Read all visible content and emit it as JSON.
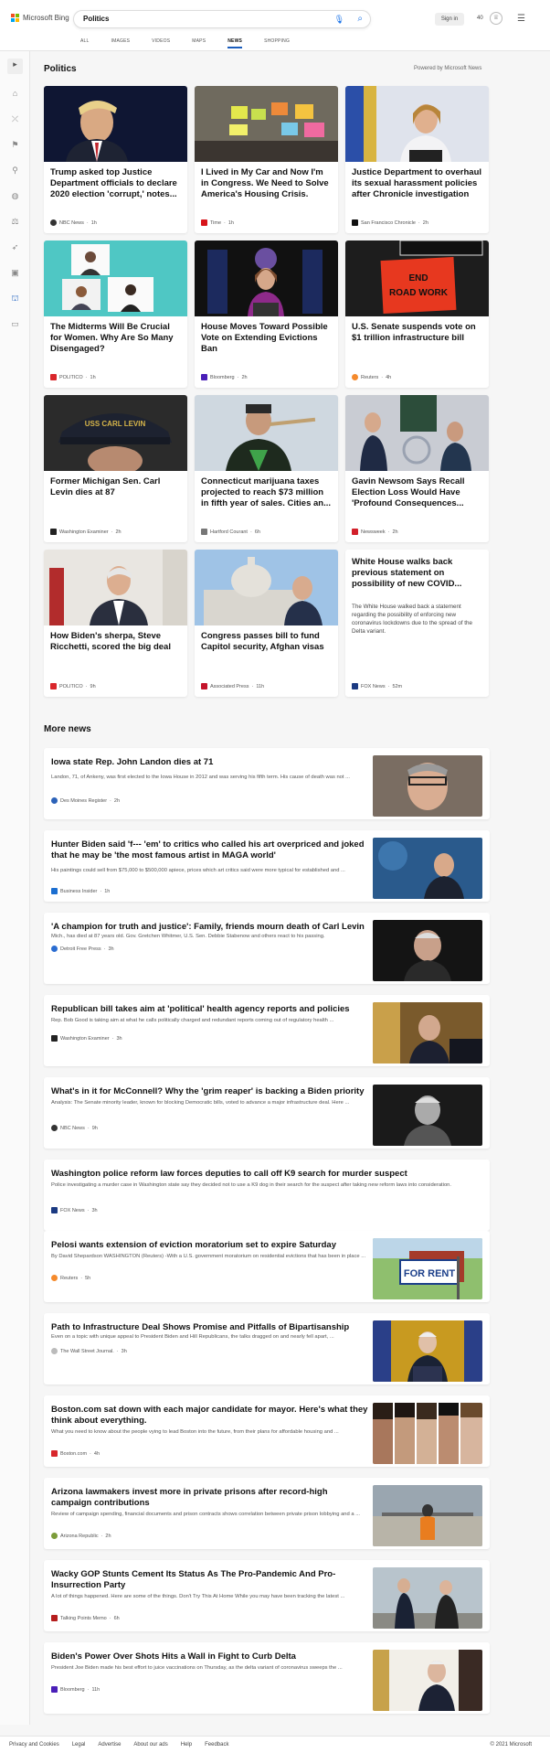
{
  "header": {
    "brand": "Microsoft Bing",
    "query": "Politics",
    "signin": "Sign in",
    "reward_points": "40",
    "tabs": [
      "ALL",
      "IMAGES",
      "VIDEOS",
      "MAPS",
      "NEWS",
      "SHOPPING"
    ],
    "active_tab": "NEWS"
  },
  "section": {
    "title": "Politics",
    "powered_by": "Powered by Microsoft News"
  },
  "cards": [
    {
      "title": "Trump asked top Justice Department officials to declare 2020 election 'corrupt,' notes...",
      "source": "NBC News",
      "age": "1h"
    },
    {
      "title": "I Lived in My Car and Now I'm in Congress. We Need to Solve America's Housing Crisis.",
      "source": "Time",
      "age": "1h"
    },
    {
      "title": "Justice Department to overhaul its sexual harassment policies after Chronicle investigation",
      "source": "San Francisco Chronicle",
      "age": "2h"
    },
    {
      "title": "The Midterms Will Be Crucial for Women. Why Are So Many Disengaged?",
      "source": "POLITICO",
      "age": "1h"
    },
    {
      "title": "House Moves Toward Possible Vote on Extending Evictions Ban",
      "source": "Bloomberg",
      "age": "2h"
    },
    {
      "title": "U.S. Senate suspends vote on $1 trillion infrastructure bill",
      "source": "Reuters",
      "age": "4h"
    },
    {
      "title": "Former Michigan Sen. Carl Levin dies at 87",
      "source": "Washington Examiner",
      "age": "2h"
    },
    {
      "title": "Connecticut marijuana taxes projected to reach $73 million in fifth year of sales. Cities an...",
      "source": "Hartford Courant",
      "age": "6h"
    },
    {
      "title": "Gavin Newsom Says Recall Election Loss Would Have 'Profound Consequences...",
      "source": "Newsweek",
      "age": "2h"
    },
    {
      "title": "How Biden's sherpa, Steve Ricchetti, scored the big deal",
      "source": "POLITICO",
      "age": "9h"
    },
    {
      "title": "Congress passes bill to fund Capitol security, Afghan visas",
      "source": "Associated Press",
      "age": "11h"
    },
    {
      "title": "White House walks back previous statement on possibility of new COVID...",
      "desc": "The White House walked back a statement regarding the possibility of enforcing new coronavirus lockdowns due to the spread of the Delta variant.",
      "source": "FOX News",
      "age": "52m"
    }
  ],
  "more_news_title": "More news",
  "more_news": [
    {
      "title": "Iowa state Rep. John Landon dies at 71",
      "desc": "Landon, 71, of Ankeny, was first elected to the Iowa House in 2012 and was serving his fifth term. His cause of death was not ...",
      "source": "Des Moines Register",
      "age": "2h"
    },
    {
      "title": "Hunter Biden said 'f--- 'em' to critics who called his art overpriced and joked that he may be 'the most famous artist in MAGA world'",
      "desc": "His paintings could sell from $75,000 to $500,000 apiece, prices which art critics said were more typical for established and ...",
      "source": "Business Insider",
      "age": "1h"
    },
    {
      "title": "'A champion for truth and justice': Family, friends mourn death of Carl Levin",
      "desc": "Mich., has died at 87 years old. Gov. Gretchen Whitmer, U.S. Sen. Debbie Stabenow and others react to his passing.",
      "source": "Detroit Free Press",
      "age": "3h"
    },
    {
      "title": "Republican bill takes aim at 'political' health agency reports and policies",
      "desc": "Rep. Bob Good is taking aim at what he calls politically charged and redundant reports coming out of regulatory health ...",
      "source": "Washington Examiner",
      "age": "3h"
    },
    {
      "title": "What's in it for McConnell? Why the 'grim reaper' is backing a Biden priority",
      "desc": "Analysis: The Senate minority leader, known for blocking Democratic bills, voted to advance a major infrastructure deal. Here ...",
      "source": "NBC News",
      "age": "9h"
    },
    {
      "title": "Washington police reform law forces deputies to call off K9 search for murder suspect",
      "desc": "Police investigating a murder case in Washington state say they decided not to use a K9 dog in their search for the suspect after taking new reform laws into consideration.",
      "source": "FOX News",
      "age": "3h"
    },
    {
      "title": "Pelosi wants extension of eviction moratorium set to expire Saturday",
      "desc": "By David Shepardson WASHINGTON (Reuters) -With a U.S. government moratorium on residential evictions that has been in place ...",
      "source": "Reuters",
      "age": "5h"
    },
    {
      "title": "Path to Infrastructure Deal Shows Promise and Pitfalls of Bipartisanship",
      "desc": "Even on a topic with unique appeal to President Biden and Hill Republicans, the talks dragged on and nearly fell apart, ...",
      "source": "The Wall Street Journal.",
      "age": "3h"
    },
    {
      "title": "Boston.com sat down with each major candidate for mayor. Here's what they think about everything.",
      "desc": "What you need to know about the people vying to lead Boston into the future, from their plans for affordable housing and ...",
      "source": "Boston.com",
      "age": "4h"
    },
    {
      "title": "Arizona lawmakers invest more in private prisons after record-high campaign contributions",
      "desc": "Review of campaign spending, financial documents and prison contracts shows correlation between private prison lobbying and a ...",
      "source": "Arizona Republic",
      "age": "2h"
    },
    {
      "title": "Wacky GOP Stunts Cement Its Status As The Pro-Pandemic And Pro-Insurrection Party",
      "desc": "A lot of things happened. Here are some of the things. Don't Try This At Home While you may have been tracking the latest ...",
      "source": "Talking Points Memo",
      "age": "6h"
    },
    {
      "title": "Biden's Power Over Shots Hits a Wall in Fight to Curb Delta",
      "desc": "President Joe Biden made his best effort to juice vaccinations on Thursday, as the delta variant of coronavirus sweeps the ...",
      "source": "Bloomberg",
      "age": "11h"
    }
  ],
  "image_texts": {
    "road_sign": "END ROAD WORK",
    "cap": "USS CARL LEVIN",
    "rent": "FOR RENT"
  },
  "footer": {
    "links": [
      "Privacy and Cookies",
      "Legal",
      "Advertise",
      "About our ads",
      "Help",
      "Feedback"
    ],
    "copyright": "© 2021 Microsoft"
  },
  "colors": {
    "accent": "#1a5dbd",
    "page_bg": "#f6f6f6"
  }
}
